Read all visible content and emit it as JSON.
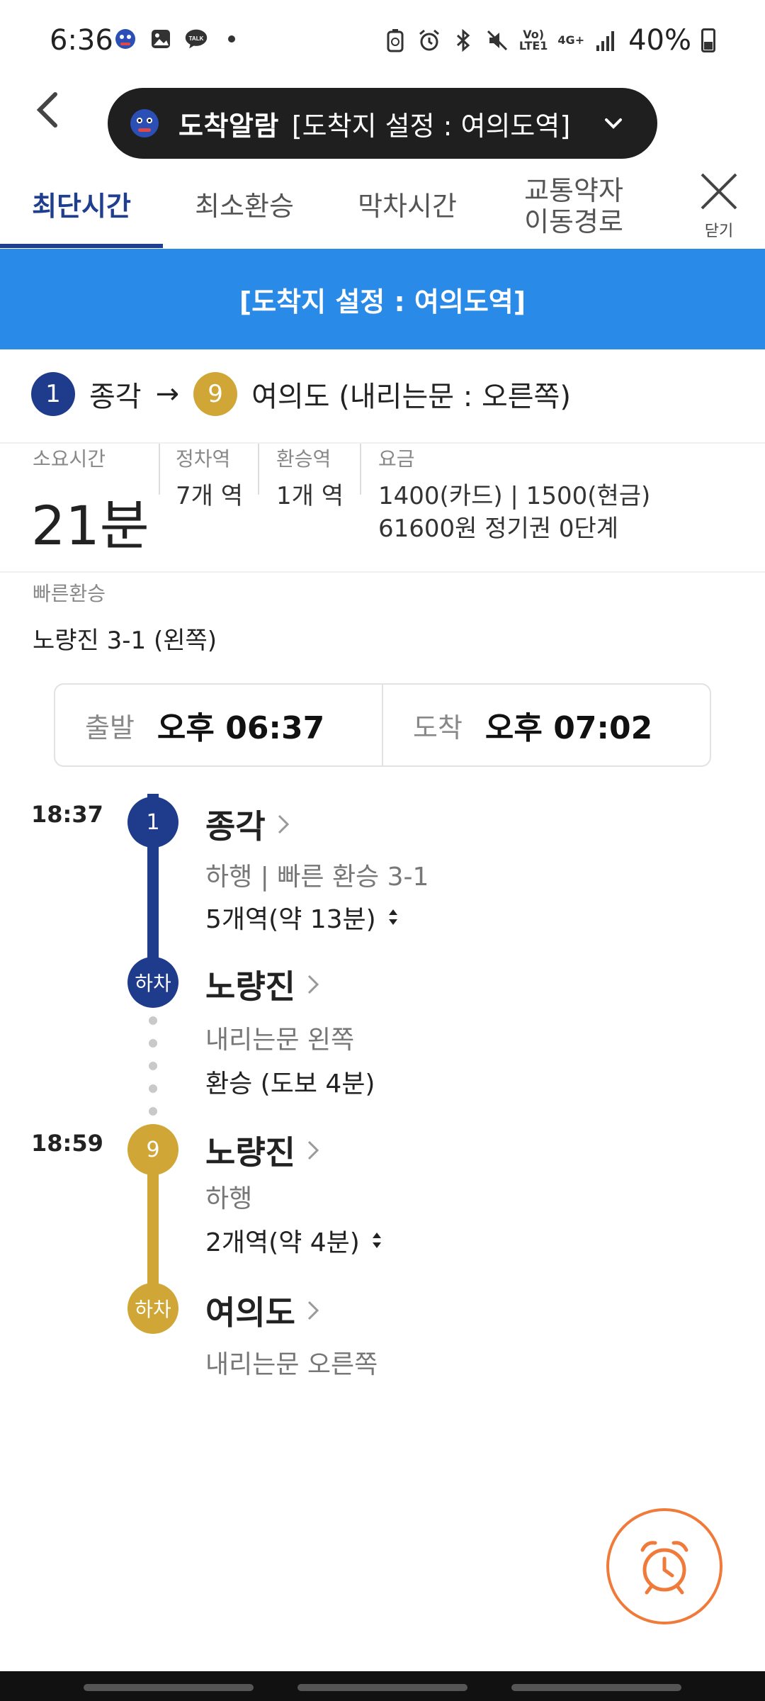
{
  "status": {
    "time": "6:36",
    "battery": "40%",
    "vo_lte": "Vo)\nLTE1",
    "network": "4G+"
  },
  "header": {
    "alarm_title": "도착알람",
    "alarm_detail": "[도착지 설정 : 여의도역]"
  },
  "tabs": [
    {
      "label": "최단시간",
      "active": true
    },
    {
      "label": "최소환승",
      "active": false
    },
    {
      "label": "막차시간",
      "active": false
    },
    {
      "label": "교통약자\n이동경로",
      "active": false
    }
  ],
  "close_label": "닫기",
  "banner": "[도착지 설정 : 여의도역]",
  "route": {
    "from_line": "1",
    "from_station": "종각",
    "arrow": "→",
    "to_line": "9",
    "to_station": "여의도 (내리는문 : 오른쪽)"
  },
  "stats": {
    "duration_label": "소요시간",
    "duration_value": "21분",
    "stops_label": "정차역",
    "stops_value": "7개 역",
    "transfer_label": "환승역",
    "transfer_value": "1개 역",
    "fare_label": "요금",
    "fare_value": "1400(카드) | 1500(현금)",
    "pass_value": "61600원 정기권 0단계"
  },
  "fast_transfer": {
    "label": "빠른환승",
    "value": "노량진 3-1 (왼쪽)"
  },
  "times": {
    "depart_label": "출발",
    "depart_value": "오후 06:37",
    "arrive_label": "도착",
    "arrive_value": "오후 07:02"
  },
  "timeline": {
    "seg1": {
      "time": "18:37",
      "line": "1",
      "station": "종각",
      "direction": "하행 | 빠른 환승 3-1",
      "stops": "5개역(약 13분)",
      "alight_label": "하차",
      "alight_station": "노량진",
      "door": "내리는문 왼쪽",
      "transfer": "환승 (도보 4분)"
    },
    "seg2": {
      "time": "18:59",
      "line": "9",
      "station": "노량진",
      "direction": "하행",
      "stops": "2개역(약 4분)",
      "alight_label": "하차",
      "alight_station": "여의도",
      "door": "내리는문 오른쪽"
    }
  },
  "colors": {
    "line1": "#1f3b8c",
    "line9": "#d0a737",
    "accent_blue": "#2a8ae8",
    "alarm_orange": "#f07a3a"
  },
  "icons": [
    "back-icon",
    "chevron-down-icon",
    "close-icon",
    "chevron-right-icon",
    "sort-updown-icon",
    "alarm-clock-icon"
  ]
}
